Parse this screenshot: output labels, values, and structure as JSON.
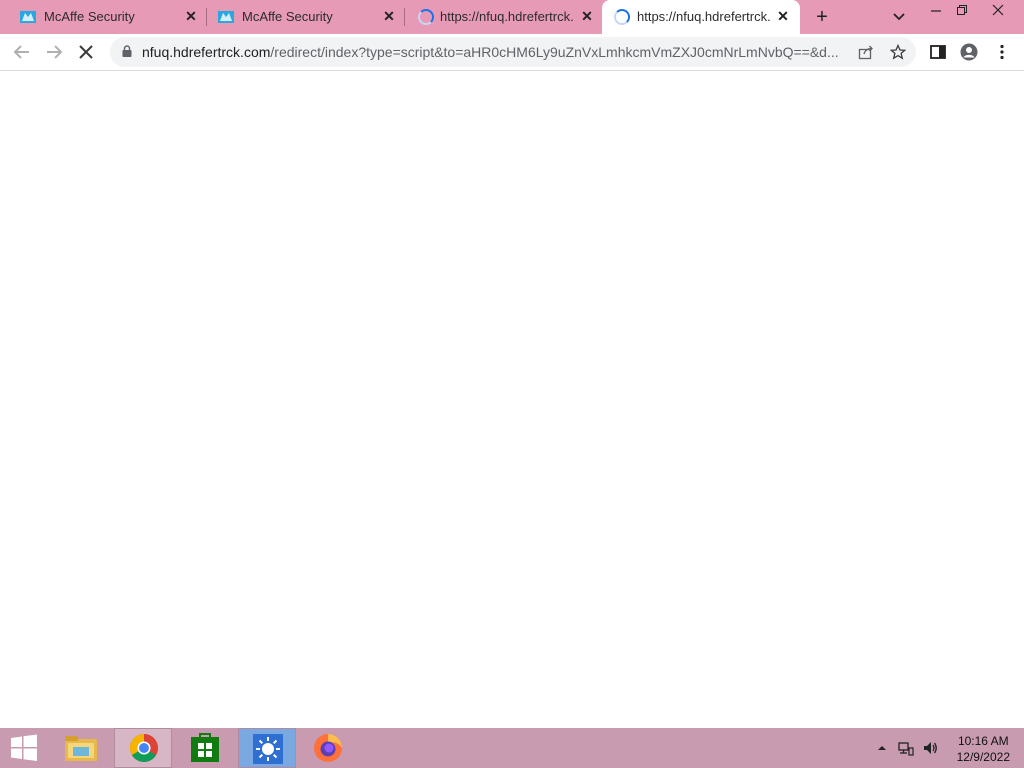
{
  "browser": {
    "tabs": [
      {
        "title": "McAffe Security",
        "favicon": "mcafee-icon",
        "active": false,
        "loading": false
      },
      {
        "title": "McAffe Security",
        "favicon": "mcafee-icon",
        "active": false,
        "loading": false
      },
      {
        "title": "https://nfuq.hdrefertrck.c",
        "favicon": "loading-spinner-icon",
        "active": false,
        "loading": true
      },
      {
        "title": "https://nfuq.hdrefertrck.c",
        "favicon": "loading-spinner-icon",
        "active": true,
        "loading": true
      }
    ],
    "new_tab": "+",
    "address_bar": {
      "host": "nfuq.hdrefertrck.com",
      "path": "/redirect/index?type=script&to=aHR0cHM6Ly9uZnVxLmhkcmVmZXJ0cmNrLmNvbQ==&d..."
    }
  },
  "taskbar": {
    "apps": [
      "start-icon",
      "file-explorer-icon",
      "chrome-icon",
      "store-icon",
      "weather-app-icon",
      "firefox-icon"
    ],
    "clock": {
      "time": "10:16 AM",
      "date": "12/9/2022"
    }
  },
  "colors": {
    "tabstrip": "#e79ab6",
    "taskbar": "#c89bb0",
    "spinner": "#1a73e8",
    "mcafee": "#29a8e0"
  }
}
